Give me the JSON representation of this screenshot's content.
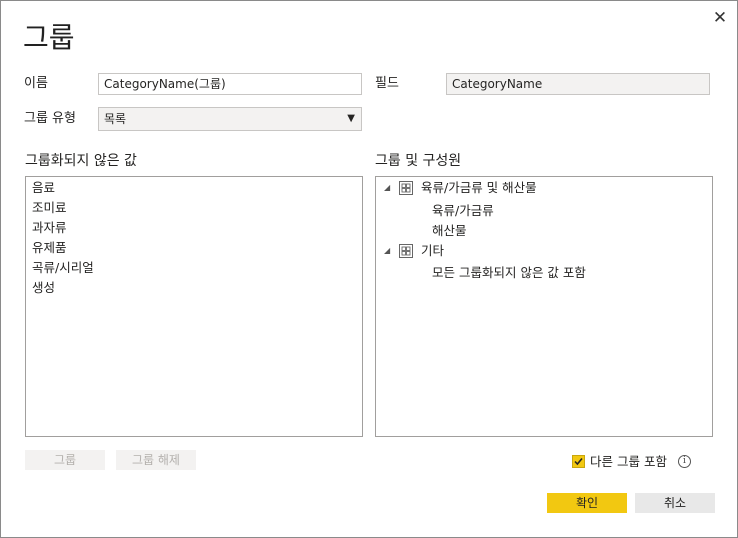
{
  "dialog": {
    "title": "그룹",
    "close_glyph": "✕"
  },
  "form": {
    "name_label": "이름",
    "name_value": "CategoryName(그룹)",
    "field_label": "필드",
    "field_value": "CategoryName",
    "type_label": "그룹 유형",
    "type_value": "목록",
    "type_arrow": "▼"
  },
  "ungrouped": {
    "header": "그룹화되지 않은 값",
    "items": [
      "음료",
      "조미료",
      "과자류",
      "유제품",
      "곡류/시리얼",
      "생성"
    ]
  },
  "groups": {
    "header": "그룹 및 구성원",
    "tree": [
      {
        "name": "육류/가금류 및 해산물",
        "members": [
          "육류/가금류",
          "해산물"
        ]
      },
      {
        "name": "기타",
        "members": [
          "모든 그룹화되지 않은 값 포함"
        ]
      }
    ],
    "expand_glyph": "◢"
  },
  "buttons": {
    "group": "그룹",
    "ungroup": "그룹 해제",
    "ok": "확인",
    "cancel": "취소"
  },
  "include_other": {
    "label": "다른 그룹 포함",
    "checked": true,
    "info_glyph": "i"
  },
  "colors": {
    "accent": "#f2c811",
    "disabled_bg": "#f3f2f1"
  }
}
